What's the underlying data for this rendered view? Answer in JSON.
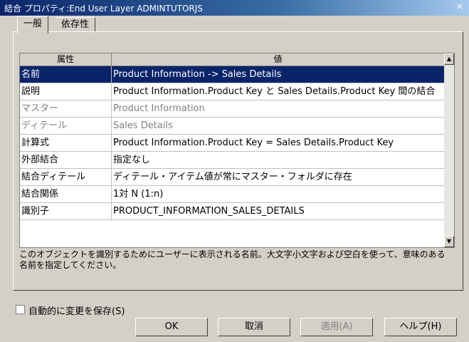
{
  "window": {
    "title": "結合 プロパティ:End User Layer  ADMINTUTORJS",
    "close_glyph": "×"
  },
  "tabs": [
    {
      "label": "一般"
    },
    {
      "label": "依存性"
    }
  ],
  "grid": {
    "col_attribute": "属性",
    "col_value": "値",
    "rows": [
      {
        "key": "名前",
        "value": "Product Information -> Sales Details"
      },
      {
        "key": "説明",
        "value": "Product Information.Product Key と Sales Details.Product Key 間の結合"
      },
      {
        "key": "マスター",
        "value": "Product Information"
      },
      {
        "key": "ディテール",
        "value": "Sales Details"
      },
      {
        "key": "計算式",
        "value": "Product Information.Product Key = Sales Details.Product Key"
      },
      {
        "key": "外部結合",
        "value": "指定なし"
      },
      {
        "key": "結合ディテール",
        "value": "ディテール・アイテム値が常にマスター・フォルダに存在"
      },
      {
        "key": "結合関係",
        "value": "1対 N (1:n)"
      },
      {
        "key": "識別子",
        "value": "PRODUCT_INFORMATION_SALES_DETAILS"
      }
    ]
  },
  "description": "このオブジェクトを識別するためにユーザーに表示される名前。大文字小文字および空白を使って、意味のある名前を指定してください。",
  "autosave_label": "自動的に変更を保存(S)",
  "buttons": {
    "ok": "OK",
    "cancel": "取消",
    "apply": "適用(A)",
    "help": "ヘルプ(H)"
  },
  "icons": {
    "scroll_up": "▲",
    "scroll_down": "▼"
  }
}
